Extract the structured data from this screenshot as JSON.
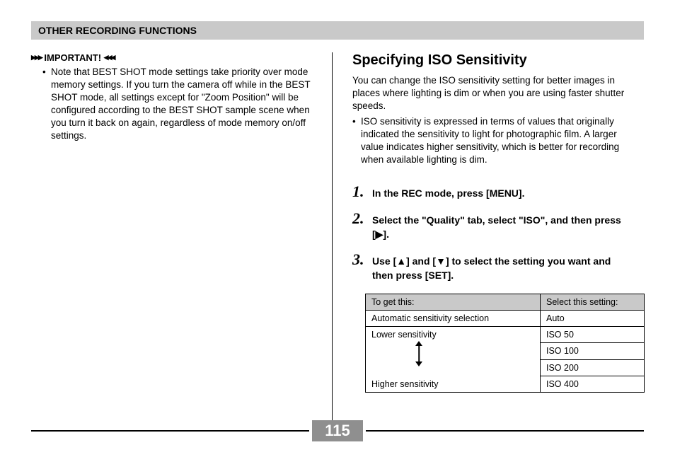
{
  "section_header": "OTHER RECORDING FUNCTIONS",
  "important_label": "IMPORTANT!",
  "important_body": "Note that BEST SHOT mode settings take priority over mode memory settings. If you turn the camera off while in the BEST SHOT mode, all settings except for \"Zoom Position\" will be configured according to the BEST SHOT sample scene when you turn it back on again, regardless of mode memory on/off settings.",
  "right_title": "Specifying ISO Sensitivity",
  "right_intro": "You can change the ISO sensitivity setting for better images in places where lighting is dim or when you are using faster shutter speeds.",
  "right_bullet": "ISO sensitivity is expressed in terms of values that originally indicated the sensitivity to light for photographic film. A larger value indicates higher sensitivity, which is better for recording when available lighting is dim.",
  "steps": [
    {
      "num": "1.",
      "txt": "In the REC mode, press [MENU]."
    },
    {
      "num": "2.",
      "txt": "Select the \"Quality\" tab, select \"ISO\", and then press [▶]."
    },
    {
      "num": "3.",
      "txt": "Use [▲] and [▼] to select the setting you want and then press [SET]."
    }
  ],
  "table": {
    "header_left": "To get this:",
    "header_right": "Select this setting:",
    "row_auto_left": "Automatic sensitivity selection",
    "row_auto_right": "Auto",
    "lower_label": "Lower sensitivity",
    "higher_label": "Higher sensitivity",
    "iso_values": [
      "ISO 50",
      "ISO 100",
      "ISO 200",
      "ISO 400"
    ]
  },
  "page_number": "115"
}
